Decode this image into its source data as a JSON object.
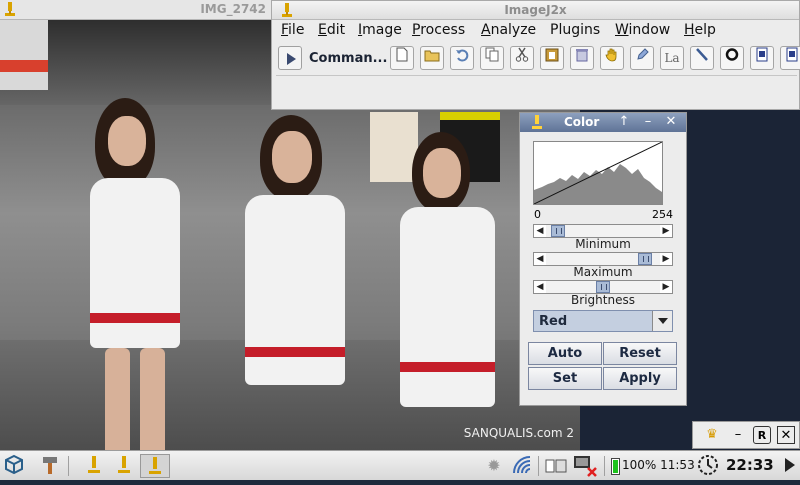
{
  "image_window": {
    "title": "IMG_2742",
    "watermark": "SANQUALIS.com 2"
  },
  "imagej": {
    "title": "ImageJ2x",
    "menus": [
      {
        "label": "File",
        "u": "F",
        "rest": "ile"
      },
      {
        "label": "Edit",
        "u": "E",
        "rest": "dit"
      },
      {
        "label": "Image",
        "u": "I",
        "rest": "mage"
      },
      {
        "label": "Process",
        "u": "P",
        "rest": "rocess"
      },
      {
        "label": "Analyze",
        "u": "A",
        "rest": "nalyze"
      },
      {
        "label": "Plugins",
        "u": "",
        "rest": "Plugins"
      },
      {
        "label": "Window",
        "u": "W",
        "rest": "indow"
      },
      {
        "label": "Help",
        "u": "H",
        "rest": "elp"
      }
    ],
    "command_label": "Comman...",
    "tools": [
      "new-icon",
      "open-icon",
      "revert-icon",
      "copy-icon",
      "cut-icon",
      "paste-icon",
      "clear-icon",
      "hand-icon",
      "pencil-icon",
      "text-tool-icon",
      "line-icon",
      "oval-icon",
      "doc-icon",
      "doc2-icon"
    ],
    "tool_glyphs": {
      "text-tool-icon": "La"
    }
  },
  "color_dialog": {
    "title": "Color",
    "hist_min": "0",
    "hist_max": "254",
    "minimum_label": "Minimum",
    "maximum_label": "Maximum",
    "brightness_label": "Brightness",
    "minimum_value": 0.05,
    "maximum_value": 0.92,
    "brightness_value": 0.5,
    "channel": "Red",
    "buttons": {
      "auto": "Auto",
      "reset": "Reset",
      "set": "Set",
      "apply": "Apply"
    },
    "title_bg": "#5f7396"
  },
  "taskbar": {
    "battery_text": "100% 11:53",
    "clock": "22:33"
  }
}
